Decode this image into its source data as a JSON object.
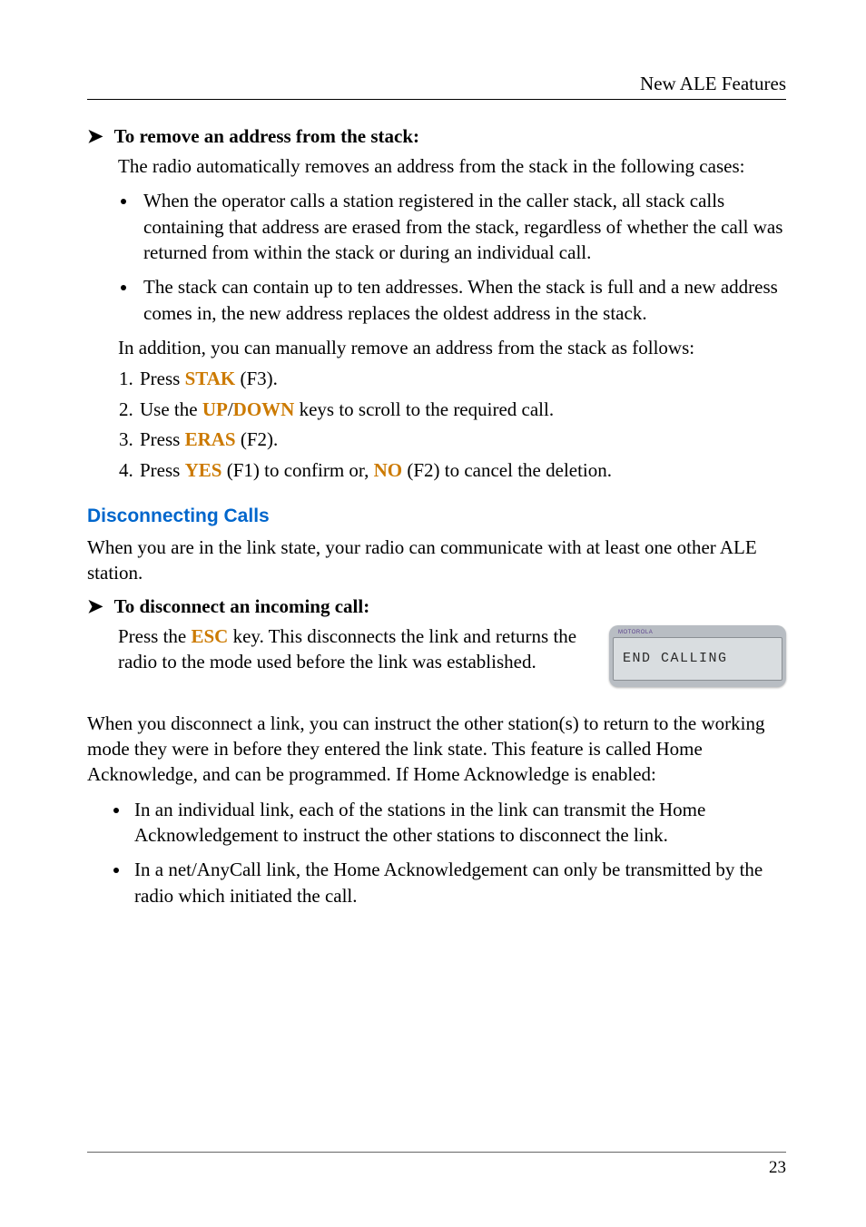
{
  "header": "New ALE Features",
  "proc1": {
    "title": "To remove an address from the stack:",
    "intro": "The radio automatically removes an address from the stack in the following cases:",
    "bullets": [
      "When the operator calls a station registered in the caller stack, all stack calls containing that address are erased from the stack, regardless of whether the call was returned from within the stack or during an individual call.",
      "The stack can contain up to ten addresses. When the stack is full and a new address comes in, the new address replaces the oldest address in the stack."
    ],
    "manual_intro": "In addition, you can manually remove an address from the stack as follows:",
    "steps": {
      "s1_pre": "Press ",
      "s1_k": "STAK",
      "s1_post": " (F3).",
      "s2_pre": "Use the ",
      "s2_k1": "UP",
      "s2_sep": "/",
      "s2_k2": "DOWN",
      "s2_post": " keys to scroll to the required call.",
      "s3_pre": "Press ",
      "s3_k": "ERAS",
      "s3_post": " (F2).",
      "s4_pre": "Press ",
      "s4_k1": "YES",
      "s4_mid": " (F1) to confirm or, ",
      "s4_k2": "NO",
      "s4_post": " (F2) to cancel the deletion."
    }
  },
  "section": {
    "title": "Disconnecting Calls",
    "intro": "When you are in the link state, your radio can communicate with at least one other ALE station."
  },
  "proc2": {
    "title": "To disconnect an incoming call:",
    "text_pre": "Press the ",
    "text_key": "ESC",
    "text_post": " key. This disconnects the link and returns the radio to the mode used before the link was established.",
    "lcd_brand": "MOTOROLA",
    "lcd": "END CALLING"
  },
  "para2": "When you disconnect a link, you can instruct the other station(s) to return to the working mode they were in before they entered the link state. This feature is called Home Acknowledge, and can be programmed. If Home Acknowledge is enabled:",
  "list2": [
    "In an individual link, each of the stations in the link can transmit the Home Acknowledgement to instruct the other stations to disconnect the link.",
    "In a net/AnyCall link, the Home Acknowledgement can only be transmitted by the radio which initiated the call."
  ],
  "page_number": "23"
}
